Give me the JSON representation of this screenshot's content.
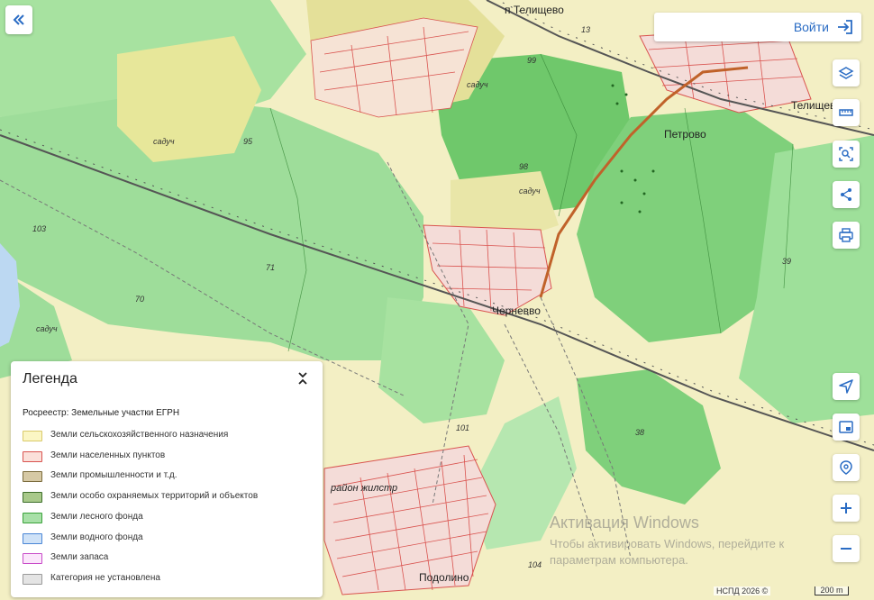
{
  "header": {
    "collapse_icon": "double-chevron-left-icon",
    "login_label": "Войти",
    "login_icon": "login-arrow-icon"
  },
  "map": {
    "places": [
      "п Телищево",
      "Телищев",
      "Петрово",
      "Черневво",
      "Подолино",
      "район жилстр"
    ],
    "garden_labels": [
      "садуч",
      "садуч",
      "садуч",
      "садуч"
    ],
    "quarter_numbers": [
      "99",
      "13",
      "95",
      "98",
      "71",
      "70",
      "103",
      "39",
      "38",
      "101",
      "104"
    ]
  },
  "toolbar_right": [
    {
      "name": "layers-button",
      "icon": "layers-icon"
    },
    {
      "name": "measure-button",
      "icon": "ruler-icon"
    },
    {
      "name": "search-area-button",
      "icon": "search-area-icon"
    },
    {
      "name": "share-button",
      "icon": "share-icon"
    },
    {
      "name": "print-button",
      "icon": "printer-icon"
    }
  ],
  "toolbar_bottom": [
    {
      "name": "locate-button",
      "icon": "navigation-arrow-icon"
    },
    {
      "name": "picture-in-picture-button",
      "icon": "picture-in-picture-icon"
    },
    {
      "name": "geo-search-button",
      "icon": "location-search-icon"
    },
    {
      "name": "zoom-in-button",
      "icon": "plus-icon",
      "label": "+"
    },
    {
      "name": "zoom-out-button",
      "icon": "minus-icon",
      "label": "−"
    }
  ],
  "legend": {
    "title": "Легенда",
    "toggle_icon": "chevron-updown-icon",
    "source": "Росреестр: Земельные участки ЕГРН",
    "items": [
      {
        "label": "Земли сельскохозяйственного назначения",
        "fill": "#fbf6c4",
        "border": "#d9c96a"
      },
      {
        "label": "Земли населенных пунктов",
        "fill": "#fbe0da",
        "border": "#d9534f"
      },
      {
        "label": "Земли промышленности и т.д.",
        "fill": "#d6c9a5",
        "border": "#7a6a3a"
      },
      {
        "label": "Земли особо охраняемых территорий и объектов",
        "fill": "#a8c98a",
        "border": "#3d6e2a"
      },
      {
        "label": "Земли лесного фонда",
        "fill": "#a8e0a8",
        "border": "#3aa23a"
      },
      {
        "label": "Земли водного фонда",
        "fill": "#cfe2f7",
        "border": "#4a86d6"
      },
      {
        "label": "Земли запаса",
        "fill": "#fbe6fb",
        "border": "#c84ac8"
      },
      {
        "label": "Категория не установлена",
        "fill": "#e4e4e4",
        "border": "#999999"
      }
    ]
  },
  "watermark": {
    "title": "Активация Windows",
    "text": "Чтобы активировать Windows, перейдите к параметрам компьютера."
  },
  "attribution": "НСПД 2026 ©",
  "scale_label": "200 m",
  "colors": {
    "forest": "#8fd88f",
    "forest_dark": "#6cc46c",
    "agricultural": "#f5f0c3",
    "settlement": "#f2d9d6",
    "railway": "#555555",
    "road": "#c0622a",
    "water": "#bcd8f2",
    "accent": "#2a6cc4"
  }
}
